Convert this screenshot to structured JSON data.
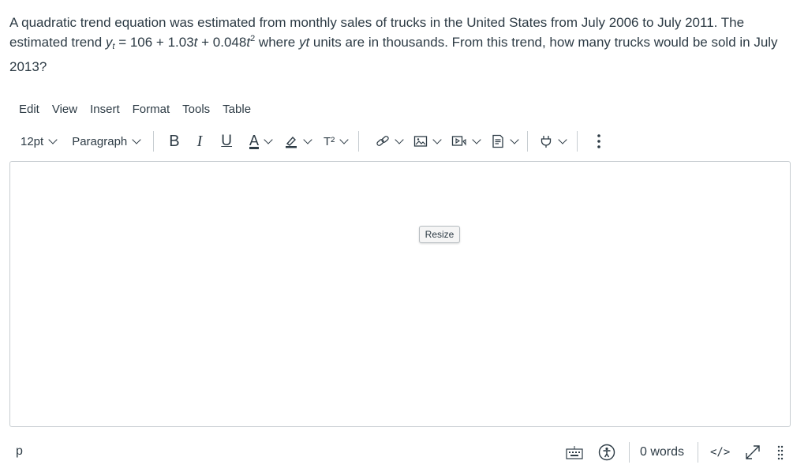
{
  "question": {
    "part1": "A quadratic trend equation was estimated from monthly sales of trucks in the United States from July 2006 to July 2011. The estimated trend ",
    "y": "y",
    "sub_t": "t",
    "part2": " = 106 + 1.03",
    "t1": "t",
    "part3": " + 0.048",
    "t2": "t",
    "sup2": "2",
    "part4": " where ",
    "yt": "yt",
    "part5": " units are in thousands. From this trend, how many trucks would be sold in July 2013?"
  },
  "menubar": {
    "items": [
      "Edit",
      "View",
      "Insert",
      "Format",
      "Tools",
      "Table"
    ]
  },
  "toolbar": {
    "font_size": "12pt",
    "block_format": "Paragraph",
    "bold": "B",
    "italic": "I",
    "underline": "U",
    "text_color": "A",
    "superscript": "T²"
  },
  "editor": {
    "resize_label": "Resize"
  },
  "statusbar": {
    "path": "p",
    "word_count": "0 words",
    "html_editor": "</>"
  },
  "colors": {
    "text": "#2d3b45",
    "border": "#c7cdd1"
  }
}
